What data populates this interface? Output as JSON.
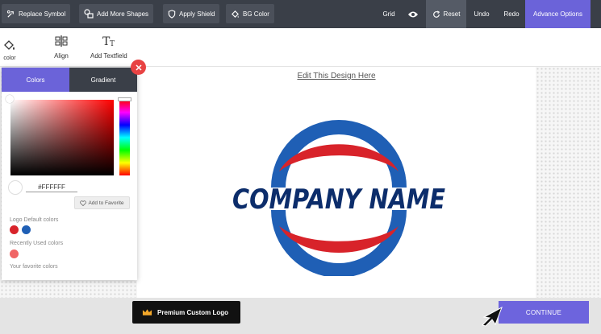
{
  "toolbar": {
    "replace_symbol": "Replace Symbol",
    "add_more_shapes": "Add More Shapes",
    "apply_shield": "Apply Shield",
    "bg_color": "BG Color",
    "grid": "Grid",
    "reset": "Reset",
    "undo": "Undo",
    "redo": "Redo",
    "advance_options": "Advance Options"
  },
  "secondary_toolbar": {
    "color": "color",
    "align": "Align",
    "add_textfield": "Add Textfield"
  },
  "color_panel": {
    "tabs": [
      "Colors",
      "Gradient"
    ],
    "active_tab": "Colors",
    "hex_value": "#FFFFFF",
    "add_to_favorite": "Add to Favorite",
    "logo_default_label": "Logo Default colors",
    "logo_default_colors": [
      "#d8232a",
      "#1f5fb5"
    ],
    "recently_used_label": "Recently Used colors",
    "recently_used_colors": [
      "#f06565"
    ],
    "favorite_label": "Your favorite colors"
  },
  "canvas": {
    "edit_link": "Edit This Design Here",
    "company_name": "COMPANY NAME",
    "logo_colors": {
      "blue": "#1f5fb5",
      "red": "#d8232a",
      "text": "#0c2d6b"
    }
  },
  "footer": {
    "premium_button": "Premium Custom Logo",
    "continue_button": "CONTINUE"
  },
  "colors": {
    "accent": "#6b63d9",
    "toolbar_bg": "#3a3f48",
    "close": "#e84343"
  }
}
